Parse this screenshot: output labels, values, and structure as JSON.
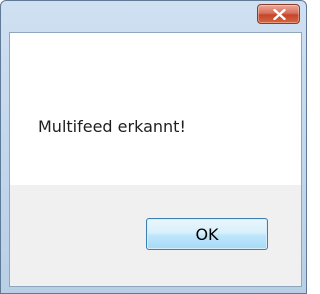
{
  "dialog": {
    "message": "Multifeed erkannt!",
    "ok_label": "OK",
    "close_icon": "close-x-icon"
  },
  "colors": {
    "close_button": "#c4462c",
    "ok_button_border": "#3c7fb1",
    "content_background": "#f0f0f0",
    "message_background": "#ffffff"
  }
}
